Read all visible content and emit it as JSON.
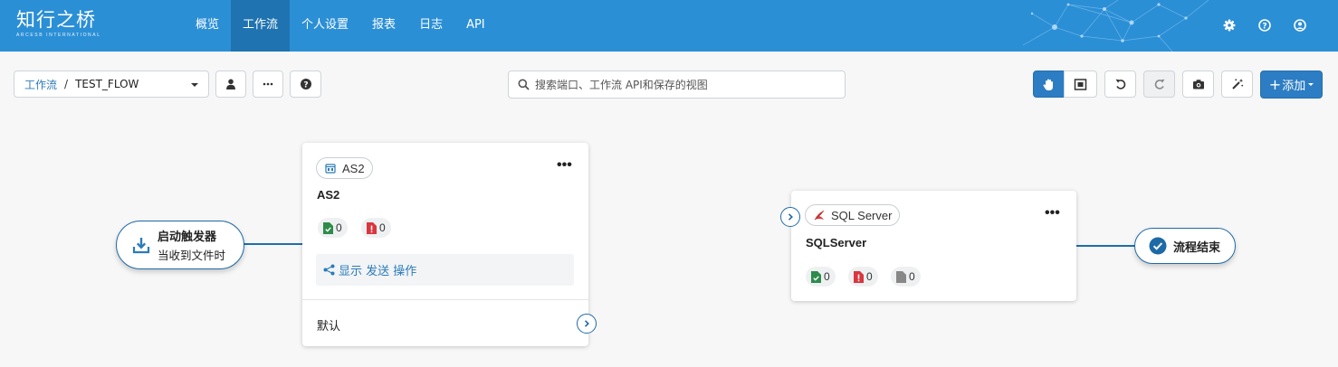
{
  "brand": {
    "name": "知行之桥",
    "tagline": "ARCESB INTERNATIONAL"
  },
  "nav": [
    {
      "label": "概览"
    },
    {
      "label": "工作流"
    },
    {
      "label": "个人设置"
    },
    {
      "label": "报表"
    },
    {
      "label": "日志"
    },
    {
      "label": "API"
    }
  ],
  "active_nav": "工作流",
  "header_icons": [
    "gear-icon",
    "help-circle-icon",
    "user-icon"
  ],
  "toolbar": {
    "breadcrumb_link": "工作流",
    "breadcrumb_sep": "/",
    "flow_name": "TEST_FLOW",
    "search_placeholder": "搜索端口、工作流 API和保存的视图",
    "add_label": "添加"
  },
  "colors": {
    "primary": "#2c7dc3",
    "nav_bg": "#2b8fd6",
    "nav_active": "#1f73b0",
    "connector": "#1f6ea8",
    "success": "#2e8b4a",
    "error": "#d9363e",
    "neutral": "#888888"
  },
  "flow": {
    "trigger": {
      "title": "启动触发器",
      "subtitle": "当收到文件时"
    },
    "as2": {
      "tag": "AS2",
      "title": "AS2",
      "success_count": "0",
      "error_count": "0",
      "show_ops_label": "显示 发送 操作",
      "default_label": "默认"
    },
    "sql": {
      "tag": "SQL Server",
      "title": "SQLServer",
      "success_count": "0",
      "error_count": "0",
      "pending_count": "0"
    },
    "end": {
      "title": "流程结束"
    }
  }
}
